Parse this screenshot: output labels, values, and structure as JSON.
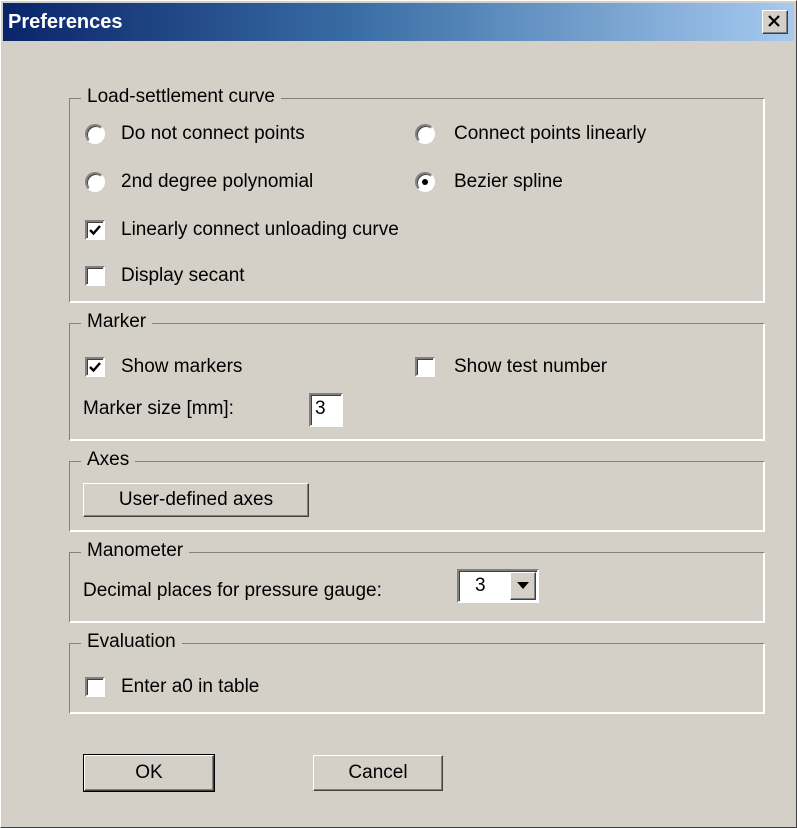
{
  "window": {
    "title": "Preferences"
  },
  "groups": {
    "curve": {
      "title": "Load-settlement curve",
      "options": [
        {
          "label": "Do not connect points",
          "selected": false
        },
        {
          "label": "Connect points linearly",
          "selected": false
        },
        {
          "label": "2nd degree polynomial",
          "selected": false
        },
        {
          "label": "Bezier spline",
          "selected": true
        }
      ],
      "checks": [
        {
          "label": "Linearly connect unloading curve",
          "checked": true
        },
        {
          "label": "Display secant",
          "checked": false
        }
      ]
    },
    "marker": {
      "title": "Marker",
      "show_markers": {
        "label": "Show markers",
        "checked": true
      },
      "show_test_number": {
        "label": "Show test number",
        "checked": false
      },
      "size_label": "Marker size [mm]:",
      "size_value": "3"
    },
    "axes": {
      "title": "Axes",
      "button": "User-defined axes"
    },
    "manometer": {
      "title": "Manometer",
      "decimal_label": "Decimal places for pressure gauge:",
      "decimal_value": "3"
    },
    "evaluation": {
      "title": "Evaluation",
      "enter_a0": {
        "label": "Enter a0 in table",
        "checked": false
      }
    }
  },
  "buttons": {
    "ok": "OK",
    "cancel": "Cancel"
  },
  "icons": {
    "close": "close-icon",
    "check": "check-mark-icon",
    "dropdown": "chevron-down-icon"
  },
  "colors": {
    "face": "#d4d0c8",
    "title_start": "#0a246a",
    "title_end": "#a6caf0"
  }
}
